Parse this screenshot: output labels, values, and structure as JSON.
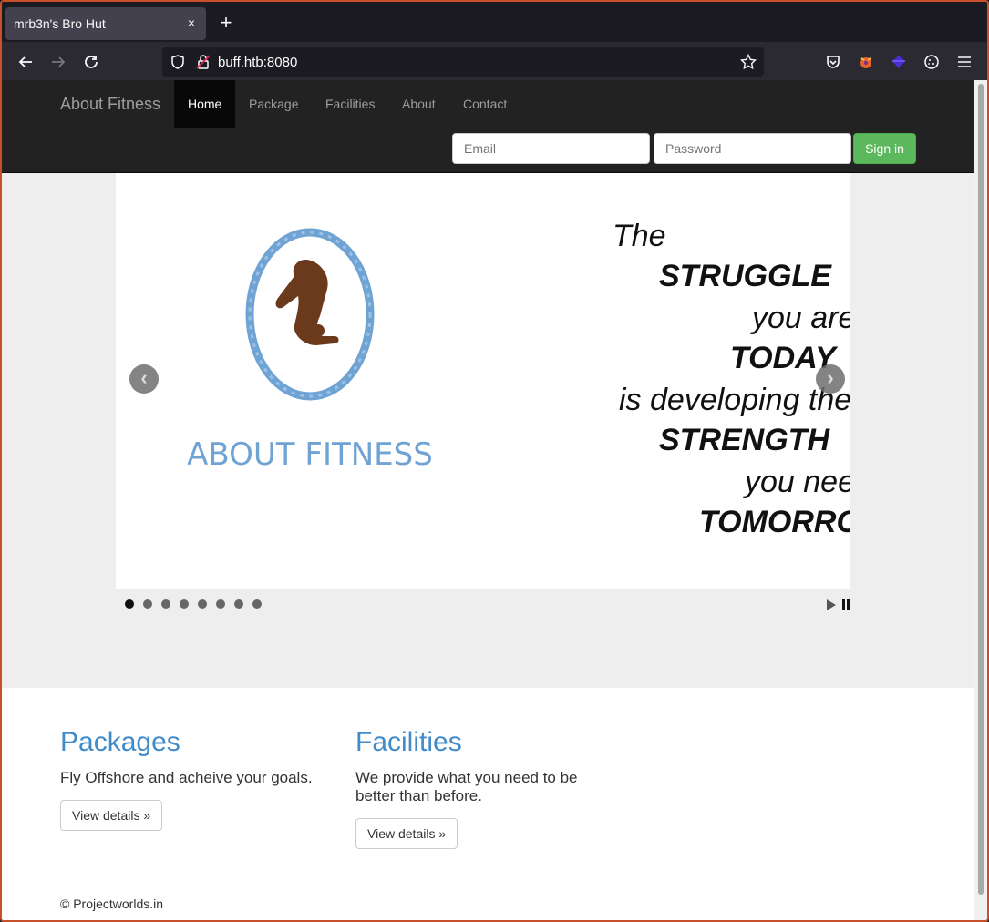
{
  "browser": {
    "tab_title": "mrb3n's Bro Hut",
    "tab_close": "×",
    "new_tab": "+",
    "url": "buff.htb:8080"
  },
  "nav": {
    "brand": "About Fitness",
    "links": [
      "Home",
      "Package",
      "Facilities",
      "About",
      "Contact"
    ],
    "active": "Home",
    "email_placeholder": "Email",
    "password_placeholder": "Password",
    "signin_label": "Sign in"
  },
  "carousel": {
    "logo_text": "ABOUT FITNESS",
    "quote_lines": [
      "The",
      "STRUGGLE",
      "you are",
      "TODAY",
      "is developing the",
      "STRENGTH",
      "you need",
      "TOMORROW"
    ],
    "prev": "‹",
    "next": "›",
    "dot_count": 8,
    "active_dot": 0
  },
  "packages": {
    "heading": "Packages",
    "text": "Fly Offshore and acheive your goals.",
    "button": "View details »"
  },
  "facilities": {
    "heading": "Facilities",
    "text": "We provide what you need to be better than before.",
    "button": "View details »"
  },
  "footer": {
    "text": "© Projectworlds.in"
  },
  "colors": {
    "brand_link": "#428bca",
    "signin_green": "#5cb85c",
    "navbar_bg": "#222222",
    "logo_blue": "#6fa3d4",
    "logo_figure": "#6b3a1c"
  }
}
